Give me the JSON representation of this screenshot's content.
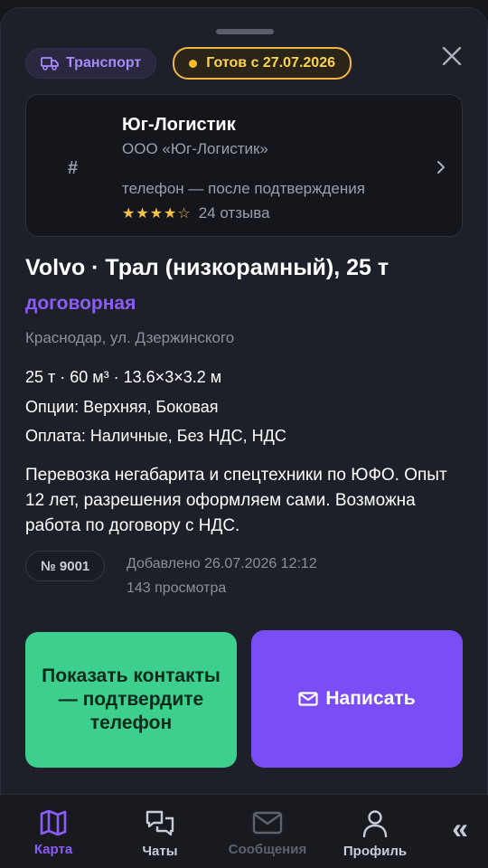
{
  "header": {
    "category_chip": "Транспорт",
    "status_chip": "Готов с 27.07.2026"
  },
  "company": {
    "avatar_symbol": "#",
    "name": "Юг-Логистик",
    "legal_name": "ООО «Юг-Логистик»",
    "phone_note": "телефон — после подтверждения",
    "stars": "★★★★☆",
    "reviews": "24 отзыва"
  },
  "listing": {
    "title": "Volvo · Трал (низкорамный), 25 т",
    "price": "договорная",
    "address": "Краснодар, ул. Дзержинского",
    "specs": "25 т · 60 м³ · 13.6×3×3.2 м",
    "options": "Опции: Верхняя, Боковая",
    "payment": "Оплата: Наличные, Без НДС, НДС",
    "description": "Перевозка негабарита и спецтехники по ЮФО. Опыт 12 лет, разрешения оформляем сами. Возможна работа по договору с НДС.",
    "id": "№ 9001",
    "added": "Добавлено 26.07.2026 12:12",
    "views": "143 просмотра"
  },
  "actions": {
    "contacts_label": "Показать контакты — подтвердите телефон",
    "write_label": "Написать"
  },
  "tabbar": {
    "map": "Карта",
    "chats": "Чаты",
    "messages": "Сообщения",
    "profile": "Профиль",
    "collapse": "«"
  },
  "colors": {
    "accent": "#8b5cf6",
    "green": "#3ccf8e",
    "gold": "#f0b545",
    "background": "#1d2028"
  }
}
